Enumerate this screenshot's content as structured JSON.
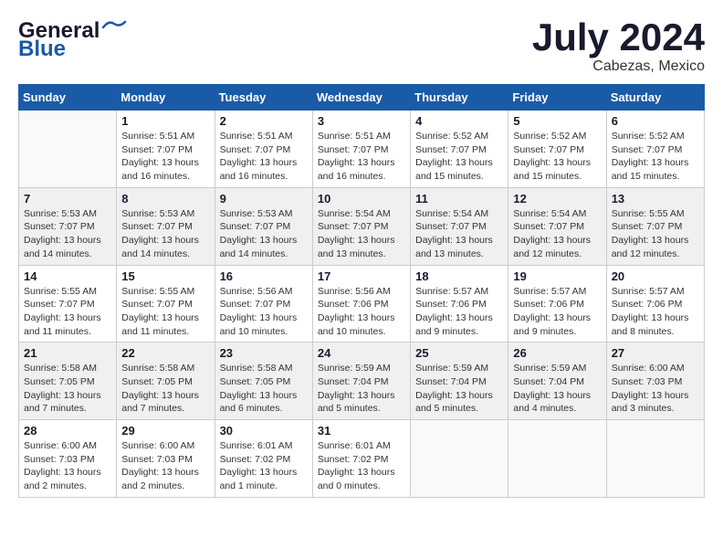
{
  "header": {
    "logo_line1": "General",
    "logo_line2": "Blue",
    "title": "July 2024",
    "location": "Cabezas, Mexico"
  },
  "days_of_week": [
    "Sunday",
    "Monday",
    "Tuesday",
    "Wednesday",
    "Thursday",
    "Friday",
    "Saturday"
  ],
  "weeks": [
    [
      {
        "day": "",
        "info": ""
      },
      {
        "day": "1",
        "info": "Sunrise: 5:51 AM\nSunset: 7:07 PM\nDaylight: 13 hours\nand 16 minutes."
      },
      {
        "day": "2",
        "info": "Sunrise: 5:51 AM\nSunset: 7:07 PM\nDaylight: 13 hours\nand 16 minutes."
      },
      {
        "day": "3",
        "info": "Sunrise: 5:51 AM\nSunset: 7:07 PM\nDaylight: 13 hours\nand 16 minutes."
      },
      {
        "day": "4",
        "info": "Sunrise: 5:52 AM\nSunset: 7:07 PM\nDaylight: 13 hours\nand 15 minutes."
      },
      {
        "day": "5",
        "info": "Sunrise: 5:52 AM\nSunset: 7:07 PM\nDaylight: 13 hours\nand 15 minutes."
      },
      {
        "day": "6",
        "info": "Sunrise: 5:52 AM\nSunset: 7:07 PM\nDaylight: 13 hours\nand 15 minutes."
      }
    ],
    [
      {
        "day": "7",
        "info": "Sunrise: 5:53 AM\nSunset: 7:07 PM\nDaylight: 13 hours\nand 14 minutes."
      },
      {
        "day": "8",
        "info": "Sunrise: 5:53 AM\nSunset: 7:07 PM\nDaylight: 13 hours\nand 14 minutes."
      },
      {
        "day": "9",
        "info": "Sunrise: 5:53 AM\nSunset: 7:07 PM\nDaylight: 13 hours\nand 14 minutes."
      },
      {
        "day": "10",
        "info": "Sunrise: 5:54 AM\nSunset: 7:07 PM\nDaylight: 13 hours\nand 13 minutes."
      },
      {
        "day": "11",
        "info": "Sunrise: 5:54 AM\nSunset: 7:07 PM\nDaylight: 13 hours\nand 13 minutes."
      },
      {
        "day": "12",
        "info": "Sunrise: 5:54 AM\nSunset: 7:07 PM\nDaylight: 13 hours\nand 12 minutes."
      },
      {
        "day": "13",
        "info": "Sunrise: 5:55 AM\nSunset: 7:07 PM\nDaylight: 13 hours\nand 12 minutes."
      }
    ],
    [
      {
        "day": "14",
        "info": "Sunrise: 5:55 AM\nSunset: 7:07 PM\nDaylight: 13 hours\nand 11 minutes."
      },
      {
        "day": "15",
        "info": "Sunrise: 5:55 AM\nSunset: 7:07 PM\nDaylight: 13 hours\nand 11 minutes."
      },
      {
        "day": "16",
        "info": "Sunrise: 5:56 AM\nSunset: 7:07 PM\nDaylight: 13 hours\nand 10 minutes."
      },
      {
        "day": "17",
        "info": "Sunrise: 5:56 AM\nSunset: 7:06 PM\nDaylight: 13 hours\nand 10 minutes."
      },
      {
        "day": "18",
        "info": "Sunrise: 5:57 AM\nSunset: 7:06 PM\nDaylight: 13 hours\nand 9 minutes."
      },
      {
        "day": "19",
        "info": "Sunrise: 5:57 AM\nSunset: 7:06 PM\nDaylight: 13 hours\nand 9 minutes."
      },
      {
        "day": "20",
        "info": "Sunrise: 5:57 AM\nSunset: 7:06 PM\nDaylight: 13 hours\nand 8 minutes."
      }
    ],
    [
      {
        "day": "21",
        "info": "Sunrise: 5:58 AM\nSunset: 7:05 PM\nDaylight: 13 hours\nand 7 minutes."
      },
      {
        "day": "22",
        "info": "Sunrise: 5:58 AM\nSunset: 7:05 PM\nDaylight: 13 hours\nand 7 minutes."
      },
      {
        "day": "23",
        "info": "Sunrise: 5:58 AM\nSunset: 7:05 PM\nDaylight: 13 hours\nand 6 minutes."
      },
      {
        "day": "24",
        "info": "Sunrise: 5:59 AM\nSunset: 7:04 PM\nDaylight: 13 hours\nand 5 minutes."
      },
      {
        "day": "25",
        "info": "Sunrise: 5:59 AM\nSunset: 7:04 PM\nDaylight: 13 hours\nand 5 minutes."
      },
      {
        "day": "26",
        "info": "Sunrise: 5:59 AM\nSunset: 7:04 PM\nDaylight: 13 hours\nand 4 minutes."
      },
      {
        "day": "27",
        "info": "Sunrise: 6:00 AM\nSunset: 7:03 PM\nDaylight: 13 hours\nand 3 minutes."
      }
    ],
    [
      {
        "day": "28",
        "info": "Sunrise: 6:00 AM\nSunset: 7:03 PM\nDaylight: 13 hours\nand 2 minutes."
      },
      {
        "day": "29",
        "info": "Sunrise: 6:00 AM\nSunset: 7:03 PM\nDaylight: 13 hours\nand 2 minutes."
      },
      {
        "day": "30",
        "info": "Sunrise: 6:01 AM\nSunset: 7:02 PM\nDaylight: 13 hours\nand 1 minute."
      },
      {
        "day": "31",
        "info": "Sunrise: 6:01 AM\nSunset: 7:02 PM\nDaylight: 13 hours\nand 0 minutes."
      },
      {
        "day": "",
        "info": ""
      },
      {
        "day": "",
        "info": ""
      },
      {
        "day": "",
        "info": ""
      }
    ]
  ]
}
